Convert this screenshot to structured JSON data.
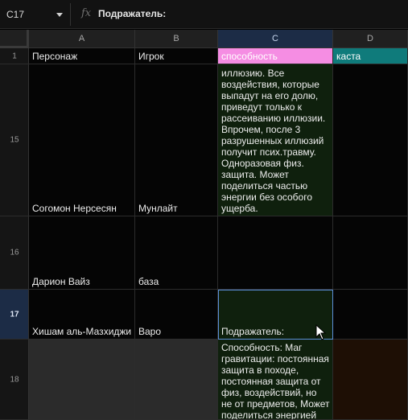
{
  "formula_bar": {
    "cell_ref": "C17",
    "fx_label": "fx",
    "content": "Подражатель:"
  },
  "columns": [
    "A",
    "B",
    "C",
    "D"
  ],
  "header_row": {
    "number": "1",
    "a": "Персонаж",
    "b": "Игрок",
    "c": "способность",
    "d": "каста"
  },
  "rows": [
    {
      "number": "15",
      "a": "Согомон Нерсесян",
      "b": "Мунлайт",
      "c": "иллюзию. Все воздействия, которые выпадут на его долю, приведут только к рассеиванию иллюзии. Впрочем, после 3 разрушенных иллюзий получит псих.травму. Одноразовая физ. защита. Может поделиться частью энергии без особого ущерба."
    },
    {
      "number": "16",
      "a": "Дарион Вайз",
      "b": "база",
      "c": ""
    },
    {
      "number": "17",
      "a": "Хишам аль-Мазхиджи",
      "b": "Варо",
      "c": "Подражатель:"
    },
    {
      "number": "18",
      "a": "",
      "b": "",
      "c": "Способность: Маг гравитации: постоянная защита в походе, постоянная защита от физ, воздействий, но не от предметов, Может поделиться энергией"
    }
  ],
  "colors": {
    "pink_header": "#f58de3",
    "teal_header": "#0f7b7b",
    "green_cell": "#0f200d",
    "selection": "#5b8ed8"
  }
}
